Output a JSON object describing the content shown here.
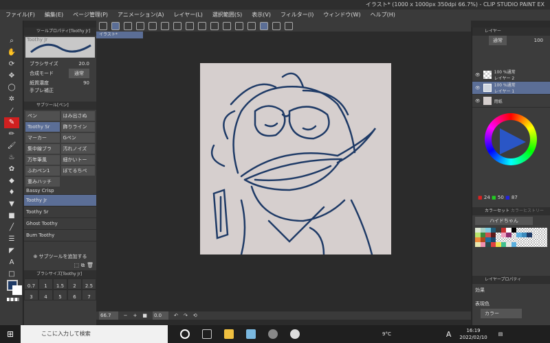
{
  "window": {
    "title": "イラスト* (1000 x 1000px 350dpi 66.7%)  - CLIP STUDIO PAINT EX"
  },
  "menu": [
    "ファイル(F)",
    "編集(E)",
    "ページ管理(P)",
    "アニメーション(A)",
    "レイヤー(L)",
    "選択範囲(S)",
    "表示(V)",
    "フィルター(I)",
    "ウィンドウ(W)",
    "ヘルプ(H)"
  ],
  "tool_property": {
    "tab": "ツールプロパティ[Toothy Jr]",
    "preview_label": "Toothy Jr",
    "brush_size_label": "ブラシサイズ",
    "brush_size": "20.0",
    "blend_label": "合成モード",
    "blend_value": "通常",
    "paper_label": "紙質濃度",
    "paper_value": "90",
    "stab_label": "手ブレ補正"
  },
  "subtool": {
    "tab": "サブツール[ペン]",
    "items": [
      "ペン",
      "はみ出さぬ",
      "Toothy Sr",
      "飾りライン",
      "マーカー",
      "Gペン",
      "集中線ブラ",
      "汚れノイズ",
      "万年筆風",
      "細かいトー",
      "ふわペン1",
      "ぼてるちペ",
      "重みハッチ"
    ],
    "list": [
      "Bassy Crisp",
      "Toothy Jr",
      "Toothy Sr",
      "Ghost Toothy",
      "Bum Toothy"
    ],
    "selected": "Toothy Jr",
    "add_label": "サブツールを追加する"
  },
  "brush_size_panel": {
    "tab": "ブラシサイズ[Toothy Jr]",
    "sizes": [
      "0.7",
      "1",
      "1.5",
      "2",
      "2.5",
      "3",
      "4",
      "5",
      "6",
      "7"
    ]
  },
  "canvas": {
    "tab": "イラスト*",
    "zoom": "66.7",
    "angle": "0.0",
    "paper_color": "#d6cfce",
    "stroke_color": "#1e3a66"
  },
  "layers": {
    "tab": "レイヤー",
    "blend": "通常",
    "opacity": "100",
    "items": [
      {
        "mode": "100 %通常",
        "name": "レイヤー 2"
      },
      {
        "mode": "100 %通常",
        "name": "レイヤー 1",
        "selected": true
      },
      {
        "mode": "",
        "name": "用紙"
      }
    ]
  },
  "color": {
    "main": "#1e3a66",
    "r": "24",
    "g": "50",
    "b": "87"
  },
  "color_set": {
    "tab": "カラーセット",
    "tab2": "カラーヒストリー",
    "set_name": "ハイドちゃん",
    "swatches": [
      "#dfe9d6",
      "#a8cfc3",
      "#7ccbe0",
      "#1f5f7c",
      "#3a3a3a",
      "#c83232",
      "#ffffff",
      "#000000",
      "#cccccc",
      "#cccccc",
      "#cccccc",
      "#cccccc",
      "#cccccc",
      "#cccccc",
      "#b8e46c",
      "#3c8a3c",
      "#d05050",
      "#5a1b1b",
      "#cccccc",
      "#f0a0c0",
      "#8a2e6e",
      "#cccccc",
      "#5aaede",
      "#3c8cbe",
      "#1e3a66",
      "#cccccc",
      "#cccccc",
      "#cccccc",
      "#f08c3c",
      "#b04a1a",
      "#1a6e9e",
      "#1a4a6e",
      "#cccccc",
      "#cccccc",
      "#cccccc",
      "#cccccc",
      "#cccccc",
      "#cccccc",
      "#cccccc",
      "#cccccc",
      "#cccccc",
      "#cccccc",
      "#e8e8b0",
      "#f090b0",
      "#2a4a4a",
      "#e04040",
      "#f0e050",
      "#40c090",
      "#e8e8e0",
      "#5ab0e0",
      "#cccccc",
      "#cccccc",
      "#cccccc",
      "#cccccc",
      "#cccccc",
      "#cccccc"
    ]
  },
  "layer_property": {
    "tab": "レイヤープロパティ",
    "effect_label": "効果",
    "expression_label": "表現色",
    "expression_value": "カラー"
  },
  "taskbar": {
    "search_placeholder": "ここに入力して検索",
    "weather": "9°C",
    "time": "16:19",
    "date": "2022/02/10",
    "ime": "A"
  }
}
